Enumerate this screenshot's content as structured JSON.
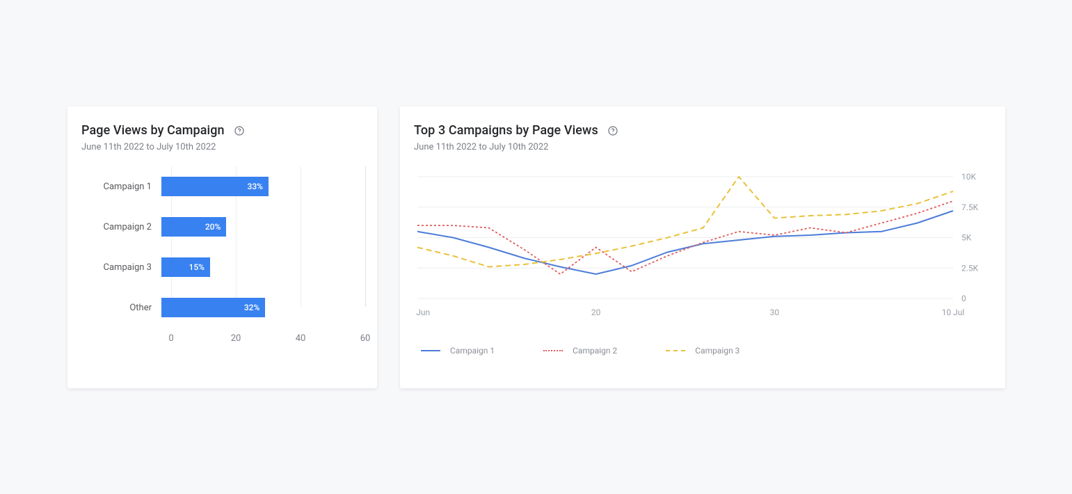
{
  "chart_data": [
    {
      "type": "bar",
      "orientation": "horizontal",
      "title": "Page Views by Campaign",
      "subtitle": "June 11th 2022 to July 10th 2022",
      "categories": [
        "Campaign 1",
        "Campaign 2",
        "Campaign 3",
        "Other"
      ],
      "values": [
        33,
        20,
        15,
        32
      ],
      "value_labels": [
        "33%",
        "20%",
        "15%",
        "32%"
      ],
      "xlim": [
        0,
        60
      ],
      "x_ticks": [
        0,
        20,
        40,
        60
      ],
      "bar_color": "#3881f0"
    },
    {
      "type": "line",
      "title": "Top 3 Campaigns by Page Views",
      "subtitle": "June 11th 2022 to July 10th 2022",
      "x": [
        10,
        12,
        14,
        16,
        18,
        20,
        22,
        24,
        26,
        28,
        30,
        32,
        34,
        36,
        38,
        40
      ],
      "x_ticks": [
        {
          "value": 10,
          "label": "10 Jun"
        },
        {
          "value": 20,
          "label": "20"
        },
        {
          "value": 30,
          "label": "30"
        },
        {
          "value": 40,
          "label": "10 Jul"
        }
      ],
      "ylim": [
        0,
        10000
      ],
      "y_ticks": [
        {
          "value": 0,
          "label": "0"
        },
        {
          "value": 2500,
          "label": "2.5K"
        },
        {
          "value": 5000,
          "label": "5K"
        },
        {
          "value": 7500,
          "label": "7.5K"
        },
        {
          "value": 10000,
          "label": "10K"
        }
      ],
      "series": [
        {
          "name": "Campaign 1",
          "color": "#4c7cd9",
          "dash": "solid",
          "values": [
            5500,
            5000,
            4200,
            3300,
            2600,
            2000,
            2700,
            3800,
            4500,
            4800,
            5100,
            5200,
            5400,
            5500,
            6200,
            7200
          ]
        },
        {
          "name": "Campaign 2",
          "color": "#e15b5b",
          "dash": "dotted",
          "values": [
            6000,
            6000,
            5800,
            4000,
            2000,
            4200,
            2200,
            3500,
            4600,
            5500,
            5200,
            5800,
            5400,
            6200,
            7000,
            8000
          ]
        },
        {
          "name": "Campaign 3",
          "color": "#e9c138",
          "dash": "dashed",
          "values": [
            4200,
            3500,
            2600,
            2800,
            3200,
            3700,
            4300,
            5000,
            5800,
            10000,
            6600,
            6800,
            6900,
            7200,
            7800,
            8800
          ]
        }
      ]
    }
  ]
}
